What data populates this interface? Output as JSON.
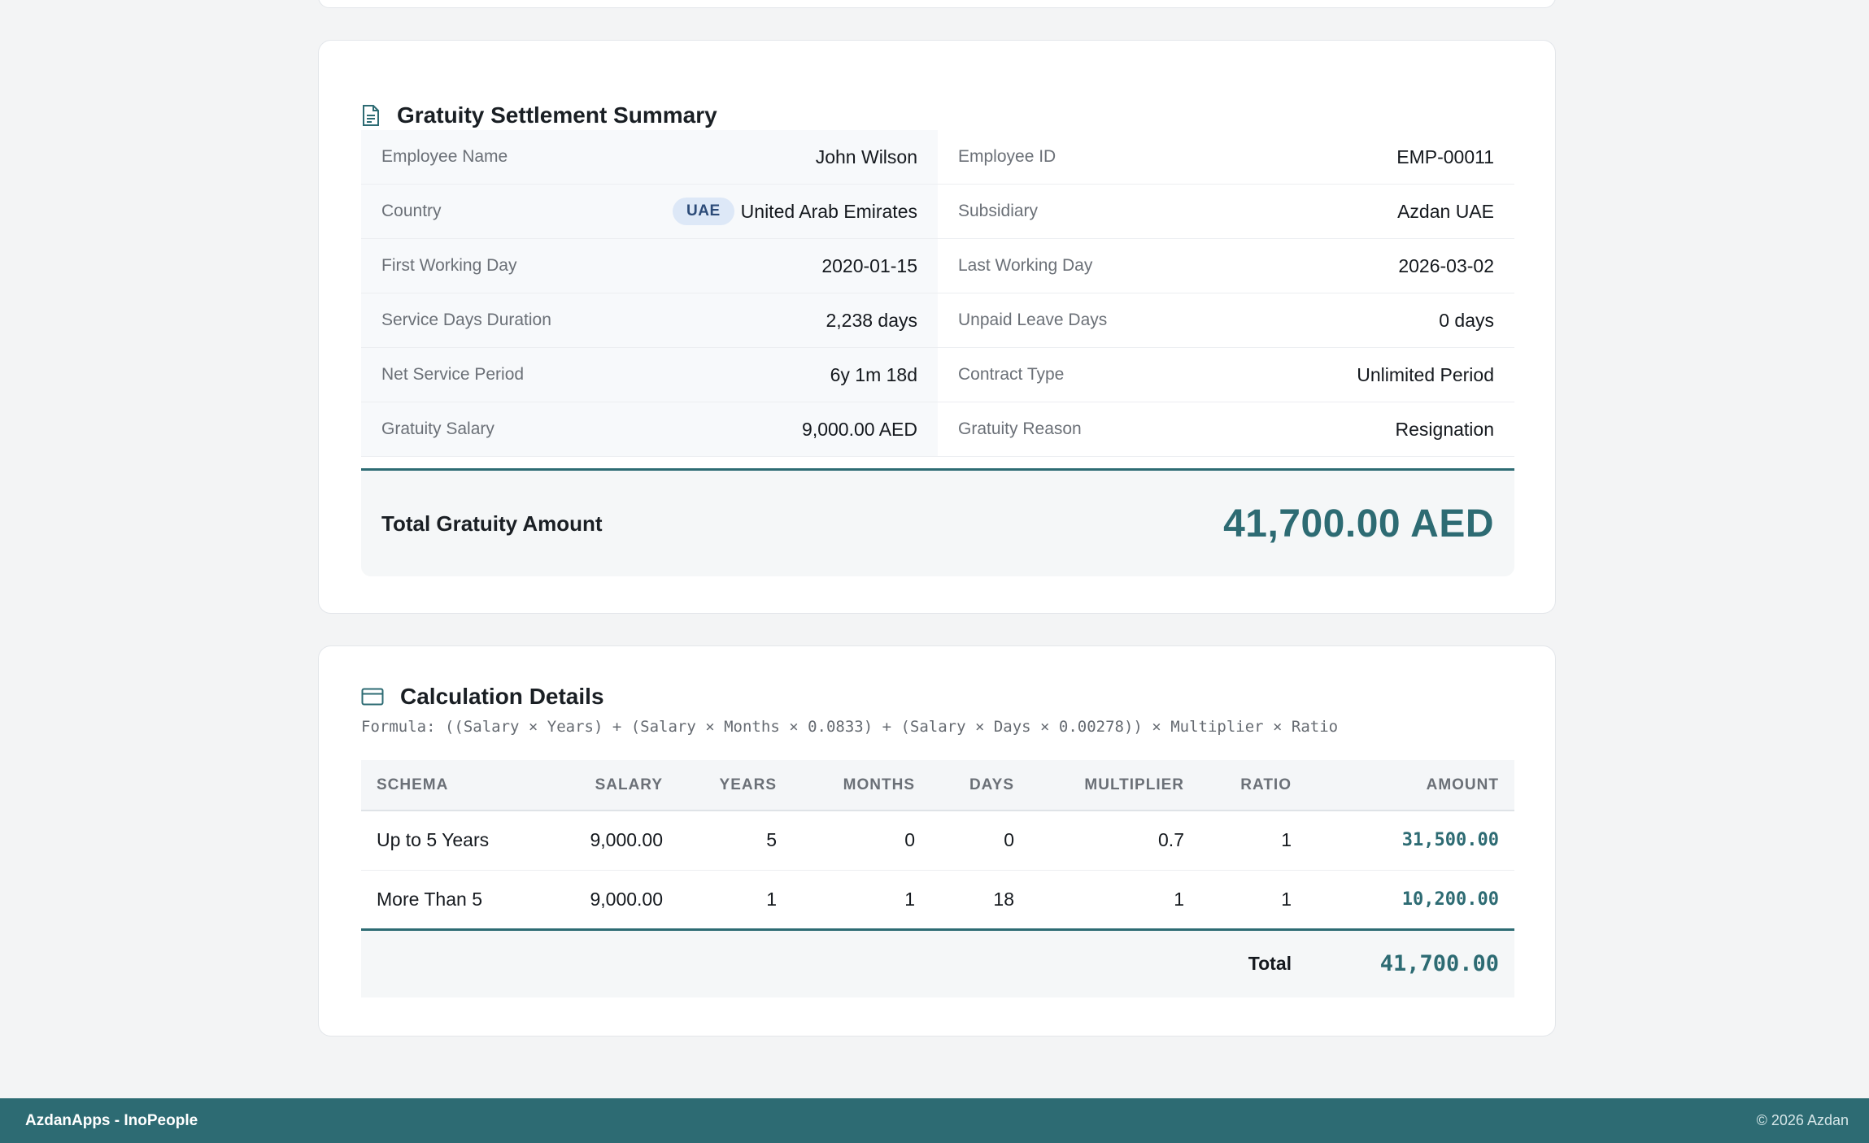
{
  "summary": {
    "title": "Gratuity Settlement Summary",
    "icon": "document-icon",
    "rows": [
      {
        "left_label": "Employee Name",
        "left_value": "John Wilson",
        "right_label": "Employee ID",
        "right_value": "EMP-00011"
      },
      {
        "left_label": "Country",
        "left_badge": "UAE",
        "left_value": "United Arab Emirates",
        "right_label": "Subsidiary",
        "right_value": "Azdan UAE"
      },
      {
        "left_label": "First Working Day",
        "left_value": "2020-01-15",
        "right_label": "Last Working Day",
        "right_value": "2026-03-02"
      },
      {
        "left_label": "Service Days Duration",
        "left_value": "2,238 days",
        "right_label": "Unpaid Leave Days",
        "right_value": "0 days"
      },
      {
        "left_label": "Net Service Period",
        "left_value": "6y 1m 18d",
        "right_label": "Contract Type",
        "right_value": "Unlimited Period"
      },
      {
        "left_label": "Gratuity Salary",
        "left_value": "9,000.00 AED",
        "right_label": "Gratuity Reason",
        "right_value": "Resignation"
      }
    ],
    "total_label": "Total Gratuity Amount",
    "total_value": "41,700.00 AED"
  },
  "calculation": {
    "title": "Calculation Details",
    "icon": "credit-card-icon",
    "formula": "Formula: ((Salary × Years) + (Salary × Months × 0.0833) + (Salary × Days × 0.00278)) × Multiplier × Ratio",
    "headers": [
      "Schema",
      "Salary",
      "Years",
      "Months",
      "Days",
      "Multiplier",
      "Ratio",
      "Amount"
    ],
    "rows": [
      [
        "Up to 5 Years",
        "9,000.00",
        "5",
        "0",
        "0",
        "0.7",
        "1",
        "31,500.00"
      ],
      [
        "More Than 5",
        "9,000.00",
        "1",
        "1",
        "18",
        "1",
        "1",
        "10,200.00"
      ]
    ],
    "total_label": "Total",
    "total_value": "41,700.00"
  },
  "footer": {
    "left": "AzdanApps - InoPeople",
    "right": "© 2026 Azdan"
  },
  "colors": {
    "accent": "#2d6b73",
    "background": "#f3f4f5",
    "badge_bg": "#dde8f7"
  }
}
